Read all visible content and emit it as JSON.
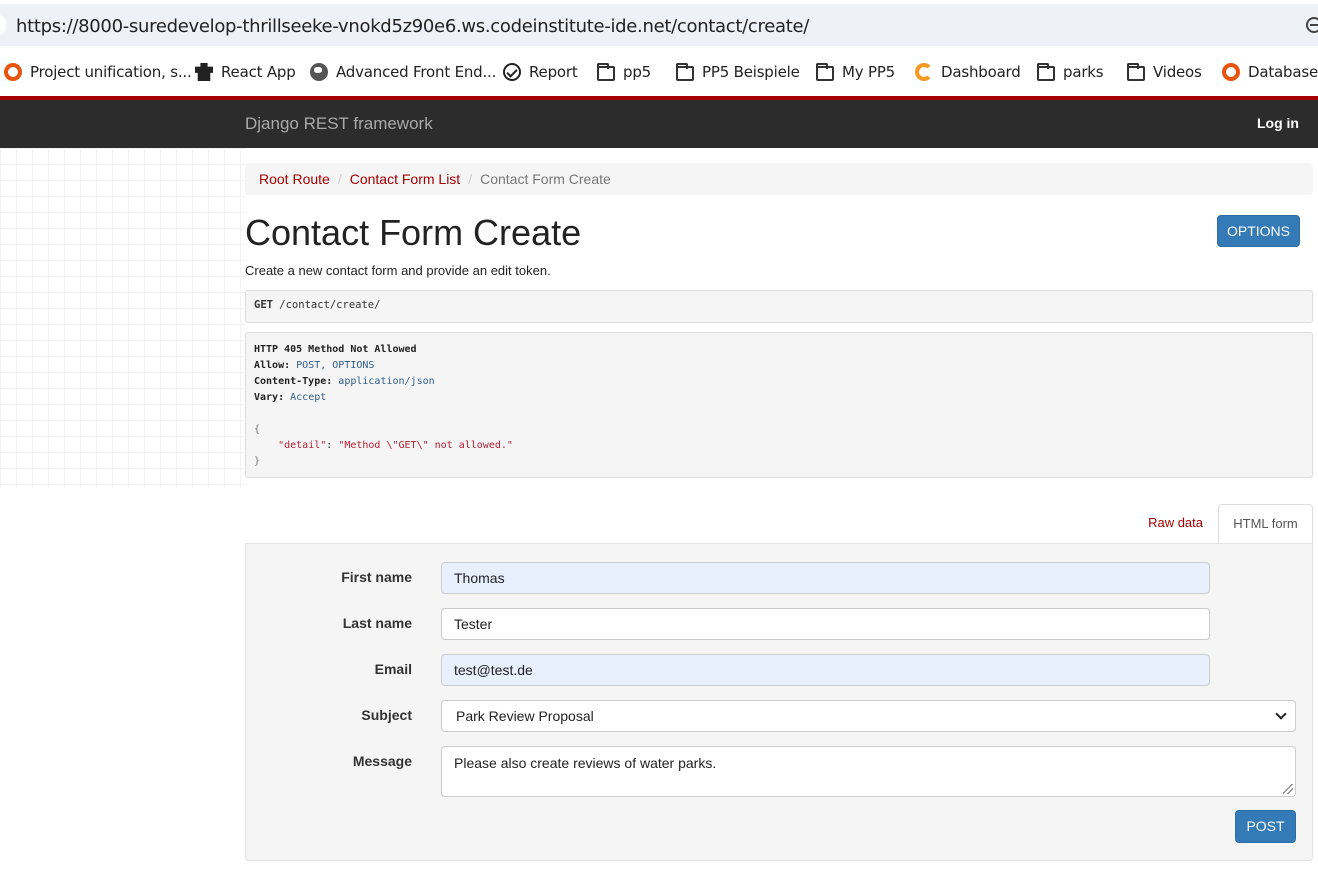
{
  "browser": {
    "url": "https://8000-suredevelop-thrillseeke-vnokd5z90e6.ws.codeinstitute-ide.net/contact/create/",
    "bookmarks": [
      {
        "label": "Project unification, s...",
        "icon": "orange-ring-icon"
      },
      {
        "label": "React App",
        "icon": "robot-icon"
      },
      {
        "label": "Advanced Front End...",
        "icon": "globe-icon"
      },
      {
        "label": "Report",
        "icon": "check-circle-icon"
      },
      {
        "label": "pp5",
        "icon": "folder-icon"
      },
      {
        "label": "PP5 Beispiele",
        "icon": "folder-icon"
      },
      {
        "label": "My PP5",
        "icon": "folder-icon"
      },
      {
        "label": "Dashboard",
        "icon": "g-logo-icon"
      },
      {
        "label": "parks",
        "icon": "folder-icon"
      },
      {
        "label": "Videos",
        "icon": "folder-icon"
      },
      {
        "label": "Database",
        "icon": "orange-ring-icon"
      }
    ]
  },
  "navbar": {
    "brand": "Django REST framework",
    "login": "Log in",
    "accent": "#a30000"
  },
  "breadcrumb": {
    "items": [
      "Root Route",
      "Contact Form List",
      "Contact Form Create"
    ]
  },
  "page": {
    "title": "Contact Form Create",
    "options_label": "OPTIONS",
    "description": "Create a new contact form and provide an edit token."
  },
  "request": {
    "method": "GET",
    "path": " /contact/create/"
  },
  "response": {
    "status_line": "HTTP 405 Method Not Allowed",
    "headers": [
      {
        "key": "Allow:",
        "value": " POST, OPTIONS"
      },
      {
        "key": "Content-Type:",
        "value": " application/json"
      },
      {
        "key": "Vary:",
        "value": " Accept"
      }
    ],
    "open_brace": "{",
    "body_key": "\"detail\"",
    "body_colon": ": ",
    "body_value": "\"Method \\\"GET\\\" not allowed.\"",
    "close_brace": "}"
  },
  "tabs": {
    "raw": "Raw data",
    "html": "HTML form"
  },
  "form": {
    "first_name_label": "First name",
    "first_name_value": "Thomas",
    "last_name_label": "Last name",
    "last_name_value": "Tester",
    "email_label": "Email",
    "email_value": "test@test.de",
    "subject_label": "Subject",
    "subject_value": "Park Review Proposal",
    "message_label": "Message",
    "message_value": "Please also create reviews of water parks.",
    "submit_label": "POST"
  },
  "colors": {
    "primary_button": "#337ab7",
    "link": "#a30000"
  }
}
